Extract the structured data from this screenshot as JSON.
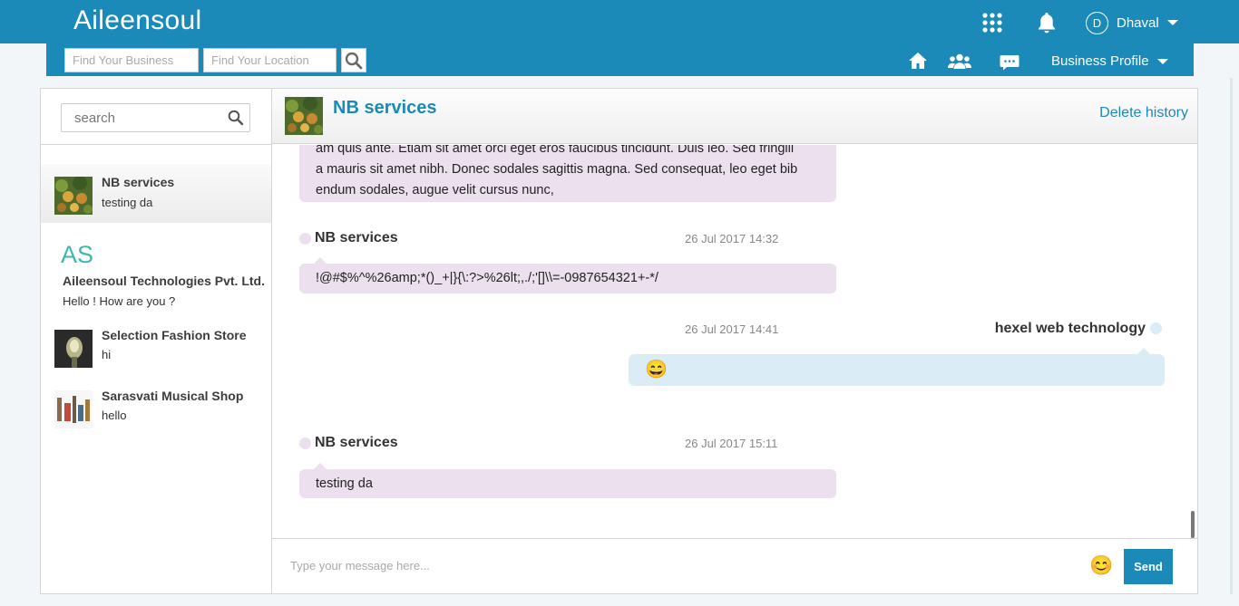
{
  "header": {
    "brand": "Aileensoul",
    "user_initial": "D",
    "user_name": "Dhaval",
    "icons": [
      "apps-grid-icon",
      "bell-icon",
      "caret-down-icon"
    ]
  },
  "subnav": {
    "business_placeholder": "Find Your Business",
    "location_placeholder": "Find Your Location",
    "business_profile_label": "Business Profile",
    "icons": [
      "search-icon",
      "home-icon",
      "people-icon",
      "chat-icon",
      "caret-down-icon"
    ]
  },
  "sidebar": {
    "search_placeholder": "search",
    "contacts": [
      {
        "name": "NB services",
        "last_message": "testing da",
        "active": true
      },
      {
        "name": "Aileensoul Technologies Pvt. Ltd.",
        "logo_text": "AS",
        "last_message": "Hello ! How are you ?"
      },
      {
        "name": "Selection Fashion Store",
        "last_message": "hi"
      },
      {
        "name": "Sarasvati Musical Shop",
        "last_message": "hello"
      }
    ]
  },
  "chat": {
    "title": "NB services",
    "delete_label": "Delete history",
    "messages": [
      {
        "sender": "",
        "time": "",
        "lines": [
          "am quis ante. Etiam sit amet orci eget eros faucibus tincidunt. Duis leo. Sed fringill",
          "a mauris sit amet nibh. Donec sodales sagittis magna. Sed consequat, leo eget bib",
          "endum sodales, augue velit cursus nunc,"
        ]
      },
      {
        "sender": "NB services",
        "time": "26 Jul 2017 14:32",
        "text": "!@#$%^%26amp;*()_+|}{\\:?>%26lt;,./;'[]\\\\=-0987654321+-*/"
      },
      {
        "sender": "hexel web technology",
        "time": "26 Jul 2017 14:41",
        "emoji": "😄"
      },
      {
        "sender": "NB services",
        "time": "26 Jul 2017 15:11",
        "text": "testing da"
      }
    ]
  },
  "composer": {
    "placeholder": "Type your message here...",
    "send_label": "Send",
    "emoji_icon": "😊"
  },
  "colors": {
    "brand_blue": "#1b8ab9",
    "incoming_bubble": "#ece0ef",
    "outgoing_bubble": "#daecf6"
  }
}
